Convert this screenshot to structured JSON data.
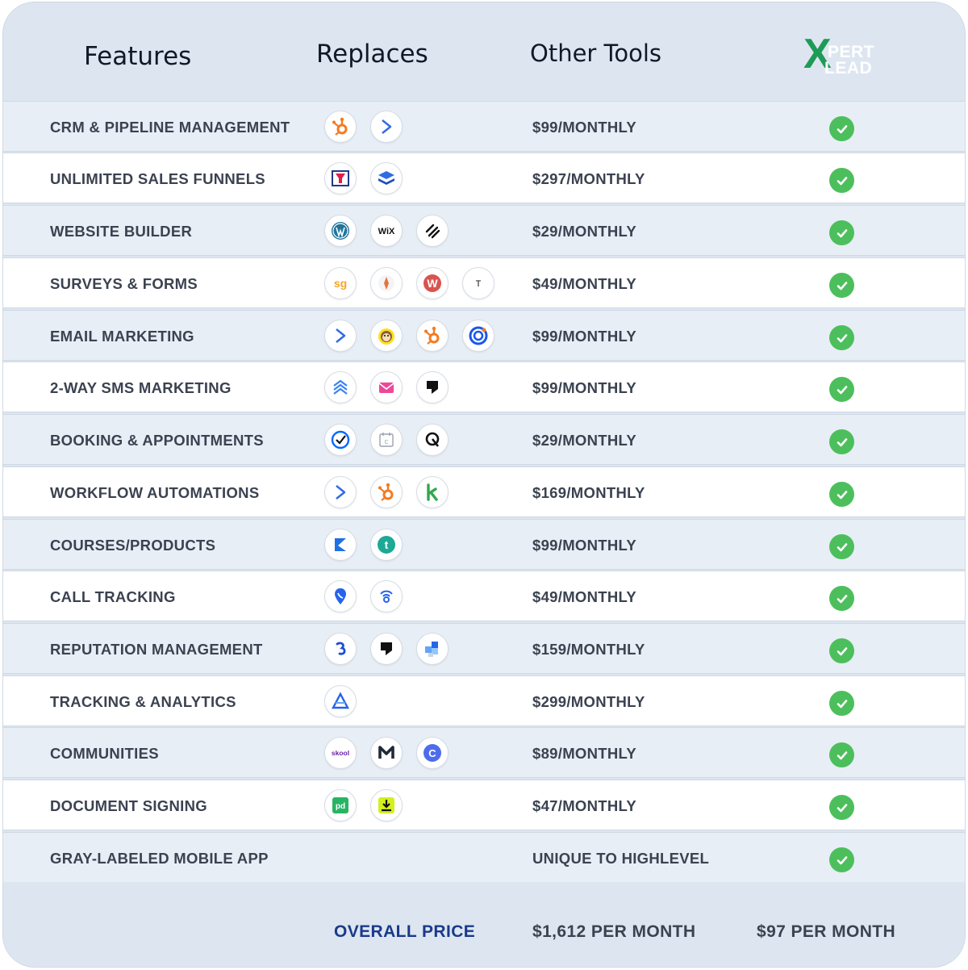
{
  "header": {
    "features": "Features",
    "replaces": "Replaces",
    "other_tools": "Other Tools",
    "logo": {
      "x": "X",
      "line1": "PERT",
      "line2": "LEAD"
    }
  },
  "colors": {
    "check": "#4cbf5c",
    "logo_x": "#1f9a57",
    "footer_label": "#1a3a8a",
    "row_alt": "#e8eef5"
  },
  "rows": [
    {
      "feature": "CRM & PIPELINE MANAGEMENT",
      "price": "$99/MONTHLY",
      "icons": [
        "hubspot-icon",
        "activecampaign-icon"
      ]
    },
    {
      "feature": "UNLIMITED SALES FUNNELS",
      "price": "$297/MONTHLY",
      "icons": [
        "clickfunnels-icon",
        "layers-icon"
      ]
    },
    {
      "feature": "WEBSITE BUILDER",
      "price": "$29/MONTHLY",
      "icons": [
        "wordpress-icon",
        "wix-icon",
        "squarespace-icon"
      ]
    },
    {
      "feature": "SURVEYS & FORMS",
      "price": "$49/MONTHLY",
      "icons": [
        "surveygizmo-icon",
        "compass-icon",
        "wufoo-icon",
        "typeform-icon"
      ]
    },
    {
      "feature": "EMAIL MARKETING",
      "price": "$99/MONTHLY",
      "icons": [
        "activecampaign-icon",
        "mailchimp-icon",
        "hubspot-icon",
        "constantcontact-icon"
      ]
    },
    {
      "feature": "2-WAY SMS MARKETING",
      "price": "$99/MONTHLY",
      "icons": [
        "waves-icon",
        "envelope-icon",
        "podium-icon"
      ]
    },
    {
      "feature": "BOOKING & APPOINTMENTS",
      "price": "$29/MONTHLY",
      "icons": [
        "calendly-icon",
        "calendar-icon",
        "acuity-icon"
      ]
    },
    {
      "feature": "WORKFLOW AUTOMATIONS",
      "price": "$169/MONTHLY",
      "icons": [
        "activecampaign-icon",
        "hubspot-icon",
        "keap-icon"
      ]
    },
    {
      "feature": "COURSES/PRODUCTS",
      "price": "$99/MONTHLY",
      "icons": [
        "kajabi-icon",
        "teachable-icon"
      ]
    },
    {
      "feature": "CALL TRACKING",
      "price": "$49/MONTHLY",
      "icons": [
        "callrail-icon",
        "signal-icon"
      ]
    },
    {
      "feature": "REPUTATION MANAGEMENT",
      "price": "$159/MONTHLY",
      "icons": [
        "birdeye-icon",
        "podium-icon",
        "puzzle-icon"
      ]
    },
    {
      "feature": "TRACKING & ANALYTICS",
      "price": "$299/MONTHLY",
      "icons": [
        "analytics-icon"
      ]
    },
    {
      "feature": "COMMUNITIES",
      "price": "$89/MONTHLY",
      "icons": [
        "skool-icon",
        "mighty-icon",
        "circle-icon"
      ]
    },
    {
      "feature": "DOCUMENT SIGNING",
      "price": "$47/MONTHLY",
      "icons": [
        "pandadoc-icon",
        "download-icon"
      ]
    },
    {
      "feature": "GRAY-LABELED MOBILE APP",
      "price": "UNIQUE TO HIGHLEVEL",
      "icons": []
    }
  ],
  "icon_text": {
    "wix": "WiX",
    "skool": "skool",
    "typeform": "T"
  },
  "footer": {
    "label": "OVERALL PRICE",
    "other_total": "$1,612 PER MONTH",
    "our_total": "$97 PER MONTH"
  }
}
